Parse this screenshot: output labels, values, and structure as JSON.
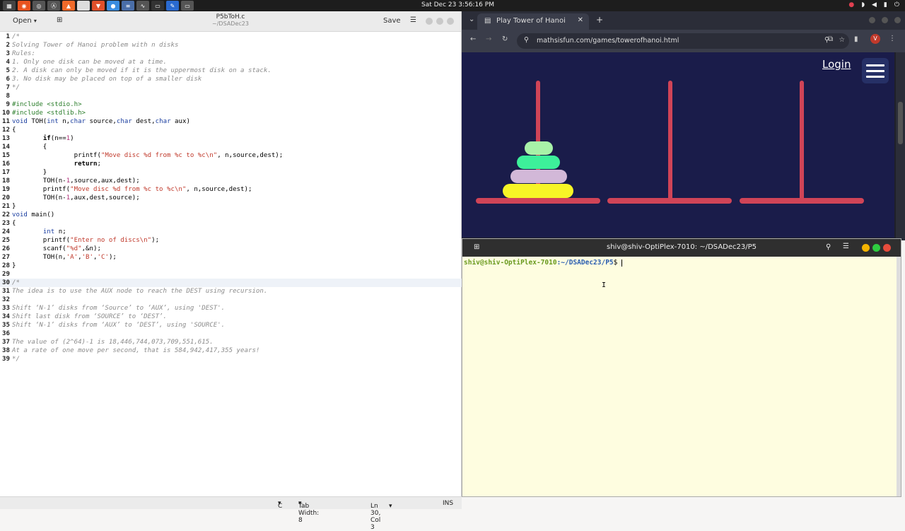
{
  "topbar": {
    "clock": "Sat Dec 23  3:56:16 PM"
  },
  "editor": {
    "open_label": "Open",
    "title": "P5bToH.c",
    "subtitle": "~/DSADec23",
    "save_label": "Save",
    "lines": [
      {
        "n": "1",
        "text": "/*"
      },
      {
        "n": "2",
        "text": "Solving Tower of Hanoi problem with n disks"
      },
      {
        "n": "3",
        "text": "Rules:"
      },
      {
        "n": "4",
        "text": "1. Only one disk can be moved at a time."
      },
      {
        "n": "5",
        "text": "2. A disk can only be moved if it is the uppermost disk on a stack."
      },
      {
        "n": "6",
        "text": "3. No disk may be placed on top of a smaller disk"
      },
      {
        "n": "7",
        "text": "*/"
      },
      {
        "n": "8",
        "text": ""
      },
      {
        "n": "9",
        "text": "#include <stdio.h>"
      },
      {
        "n": "10",
        "text": "#include <stdlib.h>"
      },
      {
        "n": "11",
        "text": "void TOH(int n,char source,char dest,char aux)"
      },
      {
        "n": "12",
        "text": "{"
      },
      {
        "n": "13",
        "text": "        if(n==1)"
      },
      {
        "n": "14",
        "text": "        {"
      },
      {
        "n": "15",
        "text": "                printf(\"Move disc %d from %c to %c\\n\", n,source,dest);"
      },
      {
        "n": "16",
        "text": "                return;"
      },
      {
        "n": "17",
        "text": "        }"
      },
      {
        "n": "18",
        "text": "        TOH(n-1,source,aux,dest);"
      },
      {
        "n": "19",
        "text": "        printf(\"Move disc %d from %c to %c\\n\", n,source,dest);"
      },
      {
        "n": "20",
        "text": "        TOH(n-1,aux,dest,source);"
      },
      {
        "n": "21",
        "text": "}"
      },
      {
        "n": "22",
        "text": "void main()"
      },
      {
        "n": "23",
        "text": "{"
      },
      {
        "n": "24",
        "text": "        int n;"
      },
      {
        "n": "25",
        "text": "        printf(\"Enter no of discs\\n\");"
      },
      {
        "n": "26",
        "text": "        scanf(\"%d\",&n);"
      },
      {
        "n": "27",
        "text": "        TOH(n,'A','B','C');"
      },
      {
        "n": "28",
        "text": "}"
      },
      {
        "n": "29",
        "text": ""
      },
      {
        "n": "30",
        "text": "/*"
      },
      {
        "n": "31",
        "text": "The idea is to use the AUX node to reach the DEST using recursion."
      },
      {
        "n": "32",
        "text": ""
      },
      {
        "n": "33",
        "text": "Shift ‘N-1’ disks from ‘Source’ to ‘AUX’, using 'DEST'."
      },
      {
        "n": "34",
        "text": "Shift last disk from ‘SOURCE’ to ‘DEST’."
      },
      {
        "n": "35",
        "text": "Shift ‘N-1’ disks from ‘AUX’ to ‘DEST’, using 'SOURCE'."
      },
      {
        "n": "36",
        "text": ""
      },
      {
        "n": "37",
        "text": "The value of (2^64)-1 is 18,446,744,073,709,551,615."
      },
      {
        "n": "38",
        "text": "At a rate of one move per second, that is 584,942,417,355 years!"
      },
      {
        "n": "39",
        "text": "*/"
      }
    ],
    "status": {
      "language": "C",
      "tab_width": "Tab Width: 8",
      "position": "Ln 30, Col 3",
      "mode": "INS"
    }
  },
  "browser": {
    "tab_title": "Play Tower of Hanoi",
    "url": "mathsisfun.com/games/towerofhanoi.html",
    "login_label": "Login",
    "disk_colors": [
      "#a8f2a8",
      "#3df09a",
      "#d2b8d8",
      "#f7f526"
    ],
    "pole_color": "#d04457"
  },
  "terminal": {
    "title": "shiv@shiv-OptiPlex-7010: ~/DSADec23/P5",
    "prompt_user": "shiv@shiv-OptiPlex-7010",
    "prompt_path": ":~/DSADec23/P5",
    "prompt_end": "$ "
  }
}
